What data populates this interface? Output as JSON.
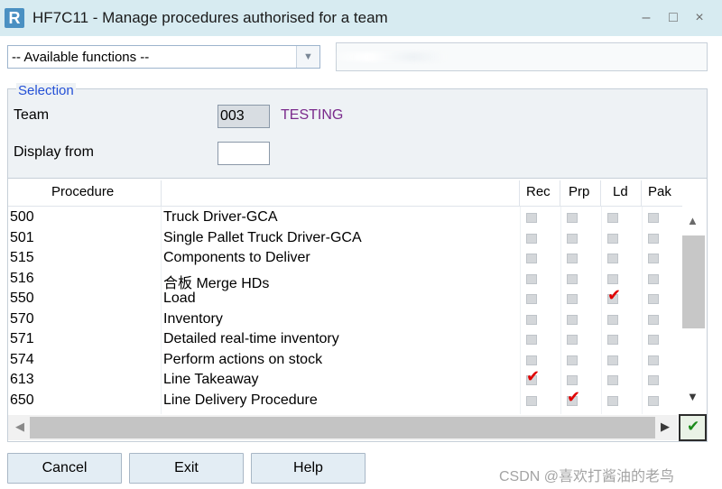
{
  "window": {
    "logo": "R",
    "title": "HF7C11 - Manage procedures authorised for a team",
    "minimize": "–",
    "maximize": "□",
    "close": "×"
  },
  "functions": {
    "selected": "-- Available functions --",
    "arrow_icon": "chevron-down-icon"
  },
  "selection": {
    "legend": "Selection",
    "team_label": "Team",
    "team_code": "003",
    "team_name": "TESTING",
    "display_from_label": "Display from",
    "display_from_value": ""
  },
  "grid": {
    "headers": {
      "procedure": "Procedure",
      "rec": "Rec",
      "prp": "Prp",
      "ld": "Ld",
      "pak": "Pak"
    },
    "rows": [
      {
        "code": "500",
        "name": "Truck Driver-GCA",
        "rec": false,
        "prp": false,
        "ld": false,
        "pak": false
      },
      {
        "code": "501",
        "name": "Single Pallet Truck Driver-GCA",
        "rec": false,
        "prp": false,
        "ld": false,
        "pak": false
      },
      {
        "code": "515",
        "name": "Components to Deliver",
        "rec": false,
        "prp": false,
        "ld": false,
        "pak": false
      },
      {
        "code": "516",
        "name": "合板 Merge HDs",
        "rec": false,
        "prp": false,
        "ld": false,
        "pak": false
      },
      {
        "code": "550",
        "name": "Load",
        "rec": false,
        "prp": false,
        "ld": true,
        "pak": false
      },
      {
        "code": "570",
        "name": "Inventory",
        "rec": false,
        "prp": false,
        "ld": false,
        "pak": false
      },
      {
        "code": "571",
        "name": "Detailed real-time inventory",
        "rec": false,
        "prp": false,
        "ld": false,
        "pak": false
      },
      {
        "code": "574",
        "name": "Perform actions on stock",
        "rec": false,
        "prp": false,
        "ld": false,
        "pak": false
      },
      {
        "code": "613",
        "name": "Line Takeaway",
        "rec": true,
        "prp": false,
        "ld": false,
        "pak": false
      },
      {
        "code": "650",
        "name": "Line Delivery Procedure",
        "rec": false,
        "prp": true,
        "ld": false,
        "pak": false
      }
    ],
    "tick_glyph": "✔",
    "scroll_up": "▲",
    "scroll_down": "▼",
    "scroll_left": "◀",
    "scroll_right": "▶",
    "ok_glyph": "✔"
  },
  "buttons": {
    "cancel": "Cancel",
    "exit": "Exit",
    "help": "Help"
  },
  "watermark": "CSDN @喜欢打酱油的老鸟",
  "colors": {
    "accent": "#2450d6",
    "team_name": "#7a2a8c",
    "tick": "#e00000",
    "ok": "#1a8a1a"
  }
}
